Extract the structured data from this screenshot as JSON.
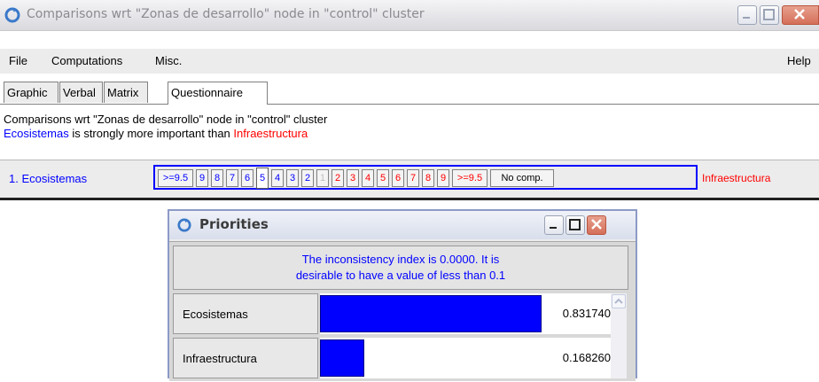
{
  "window": {
    "title": "Comparisons wrt \"Zonas de desarrollo\" node in \"control\" cluster"
  },
  "menu": {
    "file": "File",
    "computations": "Computations",
    "misc": "Misc.",
    "help": "Help"
  },
  "tabs": [
    {
      "label": "Graphic"
    },
    {
      "label": "Verbal"
    },
    {
      "label": "Matrix"
    },
    {
      "label": "Questionnaire",
      "active": true
    }
  ],
  "description": {
    "line1": "Comparisons wrt \"Zonas de desarrollo\" node in \"control\" cluster",
    "left_element": "Ecosistemas",
    "judgment": " is strongly more important than ",
    "right_element": "Infraestructura"
  },
  "comparison_row": {
    "left_label": "1.  Ecosistemas",
    "right_label": "Infraestructura",
    "scale": [
      ">=9.5",
      "9",
      "8",
      "7",
      "6",
      "5",
      "4",
      "3",
      "2",
      "1",
      "2",
      "3",
      "4",
      "5",
      "6",
      "7",
      "8",
      "9",
      ">=9.5",
      "No comp."
    ],
    "selected": "5",
    "colors": {
      "left": "#0000ff",
      "right": "#ff0000",
      "frame": "#0000ff"
    }
  },
  "priorities": {
    "title": "Priorities",
    "inconsistency_line1": "The inconsistency index is 0.0000.  It is",
    "inconsistency_line2": "desirable to have a value of less than 0.1",
    "rows": [
      {
        "name": "Ecosistemas",
        "value": "0.831740",
        "fraction": 0.83174
      },
      {
        "name": "Infraestructura",
        "value": "0.168260",
        "fraction": 0.16826
      }
    ]
  }
}
